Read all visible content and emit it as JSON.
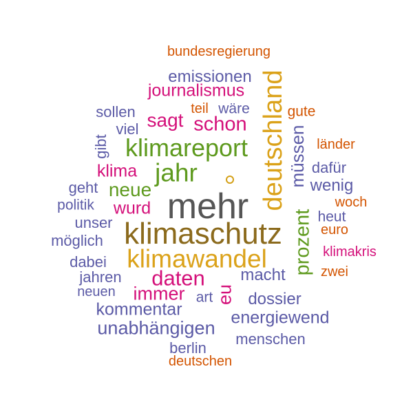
{
  "colors": {
    "orange": "#d35400",
    "purple": "#5b5aa6",
    "magenta": "#d4107a",
    "green": "#5e9a1e",
    "gold": "#dba21a",
    "brown": "#8b6a1c",
    "gray": "#555555"
  },
  "words": [
    {
      "id": "bundesregierung",
      "text": "bundesregierung",
      "color": "orange"
    },
    {
      "id": "emissionen",
      "text": "emissionen",
      "color": "purple"
    },
    {
      "id": "journalismus",
      "text": "journalismus",
      "color": "magenta"
    },
    {
      "id": "teil",
      "text": "teil",
      "color": "orange"
    },
    {
      "id": "waere",
      "text": "wäre",
      "color": "purple"
    },
    {
      "id": "sollen",
      "text": "sollen",
      "color": "purple"
    },
    {
      "id": "sagt",
      "text": "sagt",
      "color": "magenta"
    },
    {
      "id": "schon",
      "text": "schon",
      "color": "magenta"
    },
    {
      "id": "deutschland",
      "text": "deutschland",
      "color": "gold"
    },
    {
      "id": "gute",
      "text": "gute",
      "color": "orange"
    },
    {
      "id": "viel",
      "text": "viel",
      "color": "purple"
    },
    {
      "id": "gibt",
      "text": "gibt",
      "color": "purple"
    },
    {
      "id": "klimareport",
      "text": "klimareport",
      "color": "green"
    },
    {
      "id": "muessen",
      "text": "müssen",
      "color": "purple"
    },
    {
      "id": "laender",
      "text": "länder",
      "color": "orange"
    },
    {
      "id": "klima",
      "text": "klima",
      "color": "magenta"
    },
    {
      "id": "jahr",
      "text": "jahr",
      "color": "green"
    },
    {
      "id": "dafuer",
      "text": "dafür",
      "color": "purple"
    },
    {
      "id": "geht",
      "text": "geht",
      "color": "purple"
    },
    {
      "id": "neue",
      "text": "neue",
      "color": "green"
    },
    {
      "id": "wenig",
      "text": "wenig",
      "color": "purple"
    },
    {
      "id": "politik",
      "text": "politik",
      "color": "purple"
    },
    {
      "id": "wurd",
      "text": "wurd",
      "color": "magenta"
    },
    {
      "id": "mehr",
      "text": "mehr",
      "color": "gray"
    },
    {
      "id": "woch",
      "text": "woch",
      "color": "orange"
    },
    {
      "id": "heut",
      "text": "heut",
      "color": "purple"
    },
    {
      "id": "unser",
      "text": "unser",
      "color": "purple"
    },
    {
      "id": "prozent",
      "text": "prozent",
      "color": "green"
    },
    {
      "id": "euro",
      "text": "euro",
      "color": "orange"
    },
    {
      "id": "klimaschutz",
      "text": "klimaschutz",
      "color": "brown"
    },
    {
      "id": "moeglich",
      "text": "möglich",
      "color": "purple"
    },
    {
      "id": "klimakris",
      "text": "klimakris",
      "color": "magenta"
    },
    {
      "id": "klimawandel",
      "text": "klimawandel",
      "color": "gold"
    },
    {
      "id": "dabei",
      "text": "dabei",
      "color": "purple"
    },
    {
      "id": "zwei",
      "text": "zwei",
      "color": "orange"
    },
    {
      "id": "jahren",
      "text": "jahren",
      "color": "purple"
    },
    {
      "id": "daten",
      "text": "daten",
      "color": "magenta"
    },
    {
      "id": "macht",
      "text": "macht",
      "color": "purple"
    },
    {
      "id": "neuen",
      "text": "neuen",
      "color": "purple"
    },
    {
      "id": "immer",
      "text": "immer",
      "color": "magenta"
    },
    {
      "id": "eu",
      "text": "eu",
      "color": "magenta"
    },
    {
      "id": "art",
      "text": "art",
      "color": "purple"
    },
    {
      "id": "dossier",
      "text": "dossier",
      "color": "purple"
    },
    {
      "id": "kommentar",
      "text": "kommentar",
      "color": "purple"
    },
    {
      "id": "energiewend",
      "text": "energiewend",
      "color": "purple"
    },
    {
      "id": "unabhaengigen",
      "text": "unabhängigen",
      "color": "purple"
    },
    {
      "id": "menschen",
      "text": "menschen",
      "color": "purple"
    },
    {
      "id": "berlin",
      "text": "berlin",
      "color": "purple"
    },
    {
      "id": "deutschen",
      "text": "deutschen",
      "color": "orange"
    }
  ]
}
